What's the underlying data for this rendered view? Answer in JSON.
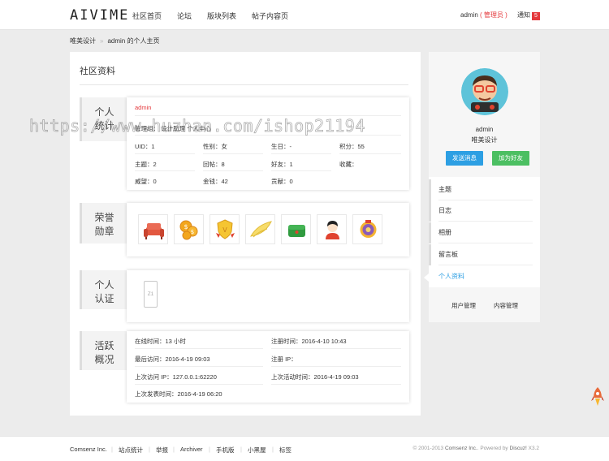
{
  "header": {
    "logo": "AIVIME",
    "nav": [
      "社区首页",
      "论坛",
      "版块列表",
      "帖子内容页"
    ],
    "user_name": "admin",
    "user_role": "管理员",
    "notice_label": "通知",
    "notice_count": "5"
  },
  "breadcrumb": {
    "home": "唯美设计",
    "sep": "»",
    "current": "admin 的个人主页"
  },
  "main": {
    "title": "社区资料",
    "sections": {
      "stats": {
        "label": "个人统计",
        "username": "admin",
        "group": "管理组",
        "group_tag": "设计助理",
        "group_extra": "个人中心",
        "fields": [
          [
            "UID：",
            "1"
          ],
          [
            "性别：",
            "女"
          ],
          [
            "生日：",
            "-"
          ],
          [
            "积分：",
            "55"
          ],
          [
            "主题：",
            "2"
          ],
          [
            "回帖：",
            "8"
          ],
          [
            "好友：",
            "1"
          ],
          [
            "收藏：",
            ""
          ],
          [
            "威望：",
            "0"
          ],
          [
            "金钱：",
            "42"
          ],
          [
            "贡献：",
            "0"
          ]
        ]
      },
      "medals": {
        "label": "荣誉勋章",
        "icons": [
          "sofa-icon",
          "coins-icon",
          "shield-medal-icon",
          "wing-icon",
          "green-box-icon",
          "girl-avatar-icon",
          "purple-badge-icon"
        ]
      },
      "verify": {
        "label": "个人认证",
        "icon": "phone-icon",
        "icon_text": "Z1"
      },
      "activity": {
        "label": "活跃概况",
        "fields": [
          [
            "在线时间：",
            "13 小时"
          ],
          [
            "注册时间：",
            "2016-4-10 10:43"
          ],
          [
            "最后访问：",
            "2016-4-19 09:03"
          ],
          [
            "注册 IP：",
            ""
          ],
          [
            "上次访问 IP：",
            "127.0.0.1:62220"
          ],
          [
            "上次活动时间：",
            "2016-4-19 09:03"
          ],
          [
            "上次发表时间：",
            "2016-4-19 06:20"
          ]
        ]
      }
    }
  },
  "sidebar": {
    "username": "admin",
    "group": "唯美设计",
    "send_message": "发送消息",
    "add_friend": "加为好友",
    "menu": [
      "主题",
      "日志",
      "相册",
      "留言板",
      "个人资料"
    ],
    "bottom_links": [
      "用户管理",
      "内容管理"
    ]
  },
  "footer": {
    "links": [
      "Comsenz Inc.",
      "站点统计",
      "举报",
      "Archiver",
      "手机版",
      "小黑屋",
      "标签"
    ],
    "copyright_prefix": "© 2001-2013",
    "copyright_company": "Comsenz Inc.",
    "powered_by": "Powered by",
    "powered_product": "Discuz!",
    "version": "X3.2"
  },
  "watermark": "https://www.huzhan.com/ishop21194",
  "colors": {
    "accent_red": "#e4393c",
    "accent_blue": "#2d9fe3",
    "accent_green": "#4cbf62"
  }
}
